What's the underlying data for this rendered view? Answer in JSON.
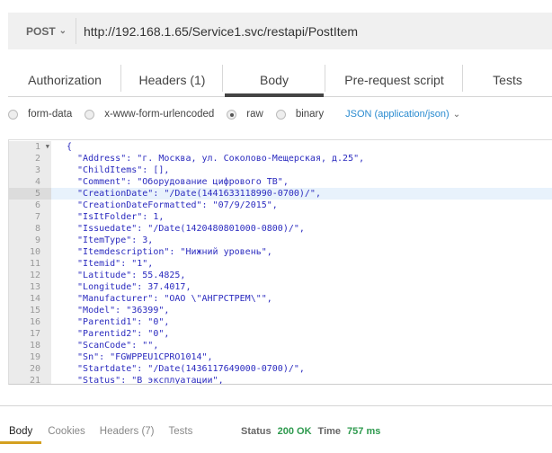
{
  "request": {
    "method": "POST",
    "url": "http://192.168.1.65/Service1.svc/restapi/PostItem"
  },
  "tabs": [
    {
      "label": "Authorization"
    },
    {
      "label": "Headers (1)"
    },
    {
      "label": "Body",
      "active": true
    },
    {
      "label": "Pre-request script"
    },
    {
      "label": "Tests"
    }
  ],
  "body_modes": [
    {
      "label": "form-data"
    },
    {
      "label": "x-www-form-urlencoded"
    },
    {
      "label": "raw",
      "selected": true
    },
    {
      "label": "binary"
    }
  ],
  "content_type": "JSON (application/json)",
  "editor": {
    "highlighted_line": 5,
    "lines": [
      "{",
      "  \"Address\": \"г. Москва, ул. Соколово-Мещерская, д.25\",",
      "  \"ChildItems\": [],",
      "  \"Comment\": \"Оборудование цифрового ТВ\",",
      "  \"CreationDate\": \"/Date(1441633118990-0700)/\",",
      "  \"CreationDateFormatted\": \"07/9/2015\",",
      "  \"IsItFolder\": 1,",
      "  \"Issuedate\": \"/Date(1420480801000-0800)/\",",
      "  \"ItemType\": 3,",
      "  \"Itemdescription\": \"Нижний уровень\",",
      "  \"Itemid\": \"1\",",
      "  \"Latitude\": 55.4825,",
      "  \"Longitude\": 37.4017,",
      "  \"Manufacturer\": \"ОАО \\\"АНГРСТРЕМ\\\"\",",
      "  \"Model\": \"36399\",",
      "  \"Parentid1\": \"0\",",
      "  \"Parentid2\": \"0\",",
      "  \"ScanCode\": \"\",",
      "  \"Sn\": \"FGWPPEU1CPRO1014\",",
      "  \"Startdate\": \"/Date(1436117649000-0700)/\",",
      "  \"Status\": \"В эксплуатации\","
    ]
  },
  "response": {
    "tabs": [
      {
        "label": "Body",
        "active": true
      },
      {
        "label": "Cookies"
      },
      {
        "label": "Headers (7)"
      },
      {
        "label": "Tests"
      }
    ],
    "status_label": "Status",
    "status": "200 OK",
    "time_label": "Time",
    "time": "757 ms"
  }
}
